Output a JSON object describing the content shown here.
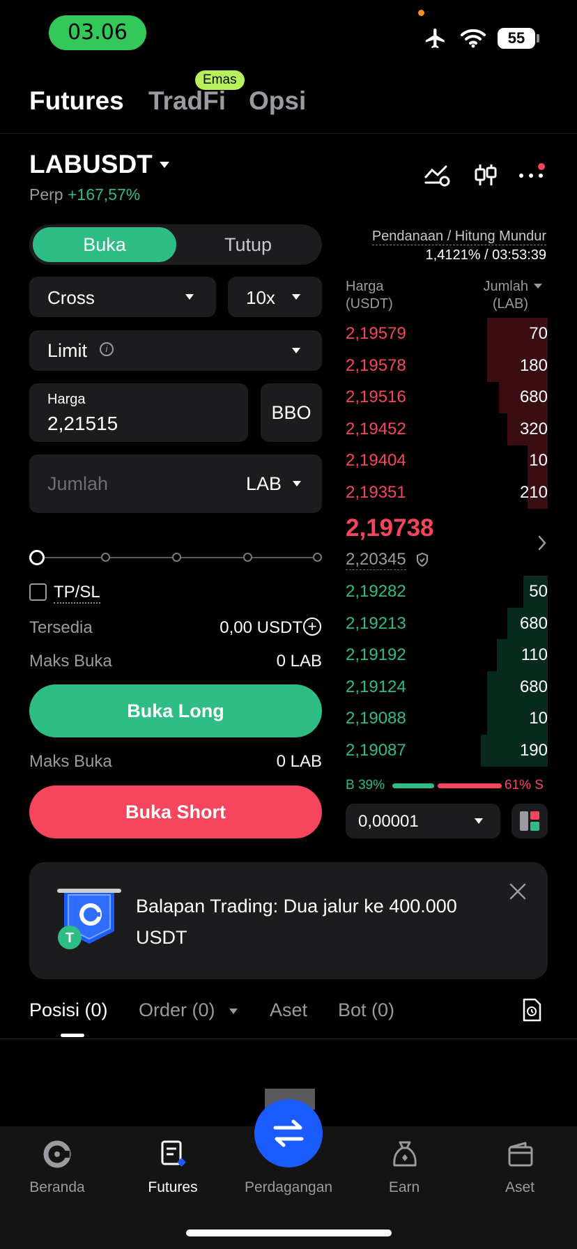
{
  "status_bar": {
    "time": "03.06",
    "battery": "55"
  },
  "top_tabs": [
    {
      "label": "Futures",
      "active": true
    },
    {
      "label": "TradFi",
      "badge": "Emas"
    },
    {
      "label": "Opsi"
    }
  ],
  "pair": {
    "symbol": "LABUSDT",
    "type": "Perp",
    "change": "+167,57%"
  },
  "funding": {
    "label": "Pendanaan / Hitung Mundur",
    "value": "1,4121% / 03:53:39"
  },
  "form": {
    "open_label": "Buka",
    "close_label": "Tutup",
    "margin_mode": "Cross",
    "leverage": "10x",
    "order_type": "Limit",
    "price_label": "Harga",
    "price_value": "2,21515",
    "bbo_label": "BBO",
    "amount_placeholder": "Jumlah",
    "amount_unit": "LAB",
    "tpsl_label": "TP/SL",
    "available_label": "Tersedia",
    "available_value": "0,00 USDT",
    "max_open_label": "Maks Buka",
    "max_open_value": "0 LAB",
    "long_button": "Buka Long",
    "short_button": "Buka Short",
    "slider_level": 0
  },
  "orderbook": {
    "price_header": "Harga",
    "price_unit": "(USDT)",
    "qty_header": "Jumlah",
    "qty_unit": "(LAB)",
    "asks": [
      {
        "price": "2,19579",
        "qty": "70",
        "depth": 0.3
      },
      {
        "price": "2,19578",
        "qty": "180",
        "depth": 0.3
      },
      {
        "price": "2,19516",
        "qty": "680",
        "depth": 0.24
      },
      {
        "price": "2,19452",
        "qty": "320",
        "depth": 0.2
      },
      {
        "price": "2,19404",
        "qty": "10",
        "depth": 0.1
      },
      {
        "price": "2,19351",
        "qty": "210",
        "depth": 0.1
      }
    ],
    "last_price": "2,19738",
    "mark_price": "2,20345",
    "bids": [
      {
        "price": "2,19282",
        "qty": "50",
        "depth": 0.12
      },
      {
        "price": "2,19213",
        "qty": "680",
        "depth": 0.2
      },
      {
        "price": "2,19192",
        "qty": "110",
        "depth": 0.25
      },
      {
        "price": "2,19124",
        "qty": "680",
        "depth": 0.3
      },
      {
        "price": "2,19088",
        "qty": "10",
        "depth": 0.3
      },
      {
        "price": "2,19087",
        "qty": "190",
        "depth": 0.33
      }
    ],
    "buy_ratio": "B 39%",
    "sell_ratio": "61% S",
    "precision": "0,00001"
  },
  "banner": {
    "text": "Balapan Trading: Dua jalur ke 400.000 USDT"
  },
  "bottom_tabs": [
    {
      "label": "Posisi (0)",
      "active": true
    },
    {
      "label": "Order (0)"
    },
    {
      "label": "Aset"
    },
    {
      "label": "Bot (0)"
    }
  ],
  "nav": [
    {
      "label": "Beranda"
    },
    {
      "label": "Futures",
      "active": true
    },
    {
      "label": "Perdagangan"
    },
    {
      "label": "Earn"
    },
    {
      "label": "Aset"
    }
  ],
  "colors": {
    "buy": "#2ebd85",
    "sell": "#f6465d",
    "accent": "#1a5cff",
    "panel": "#1c1c1e"
  }
}
